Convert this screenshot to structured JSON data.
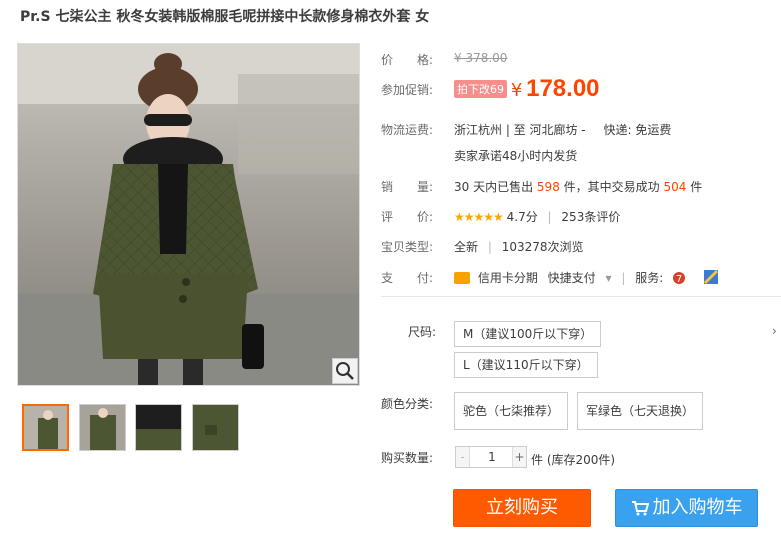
{
  "product": {
    "title": "Pr.S 七柒公主 秋冬女装韩版棉服毛呢拼接中长款修身棉衣外套 女"
  },
  "price": {
    "label": "价　　格:",
    "original": "¥ 378.00"
  },
  "promo": {
    "label": "参加促销:",
    "tag": "拍下改69",
    "currency": "¥",
    "price": "178.00"
  },
  "shipping": {
    "label": "物流运费:",
    "route": "浙江杭州 | 至  河北廊坊 -",
    "fee": "快递: 免运费",
    "promise": "卖家承诺48小时内发货"
  },
  "sales": {
    "label": "销　　量:",
    "prefix": "30 天内已售出",
    "sold": "598",
    "middle": "件，其中交易成功",
    "success": "504",
    "suffix": "件"
  },
  "rating": {
    "label": "评　　价:",
    "stars": "★★★★★",
    "score": "4.7分",
    "count": "253条评价",
    "value": 4.7
  },
  "item": {
    "label": "宝贝类型:",
    "condition": "全新",
    "views": "103278次浏览"
  },
  "payment": {
    "label": "支　　付:",
    "installment": "信用卡分期",
    "quick": "快捷支付",
    "service_label": "服务:"
  },
  "size": {
    "label": "尺码:",
    "options": [
      "M（建议100斤以下穿）",
      "L（建议110斤以下穿）"
    ]
  },
  "color": {
    "label": "颜色分类:",
    "options": [
      "驼色（七柒推荐）",
      "军绿色（七天退换）"
    ]
  },
  "quantity": {
    "label": "购买数量:",
    "minus": "-",
    "value": "1",
    "plus": "+",
    "unit": "件 (库存200件)"
  },
  "actions": {
    "buy": "立刻购买",
    "cart": "加入购物车"
  },
  "colors": {
    "accent": "#ff4400",
    "buy_button": "#ff5a00",
    "cart_button": "#3aa1ee",
    "coat": "#4a5230"
  }
}
